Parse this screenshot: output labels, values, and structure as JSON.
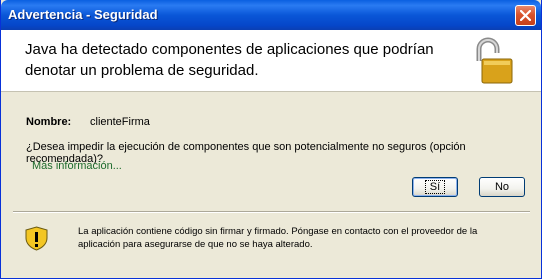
{
  "window": {
    "title": "Advertencia - Seguridad"
  },
  "header": {
    "message": "Java ha detectado componentes de aplicaciones que podrían denotar un problema de seguridad."
  },
  "details": {
    "name_label": "Nombre:",
    "name_value": "clienteFirma",
    "question": "¿Desea impedir la ejecución de componentes que son potencialmente no seguros (opción recomendada)?",
    "more_info_link": "Más información..."
  },
  "buttons": {
    "yes_label": "Sí",
    "no_label": "No"
  },
  "footer": {
    "warning_text": "La aplicación contiene código sin firmar y firmado. Póngase en contacto con el proveedor de la aplicación para asegurarse de que no se haya alterado."
  },
  "icons": {
    "close": "close-icon",
    "lock": "unlocked-padlock-icon",
    "warning": "warning-shield-icon"
  },
  "colors": {
    "titlebar": "#0a57d8",
    "close_button": "#d9532d",
    "link": "#1e6b2d",
    "dialog_background": "#ece9d8"
  }
}
